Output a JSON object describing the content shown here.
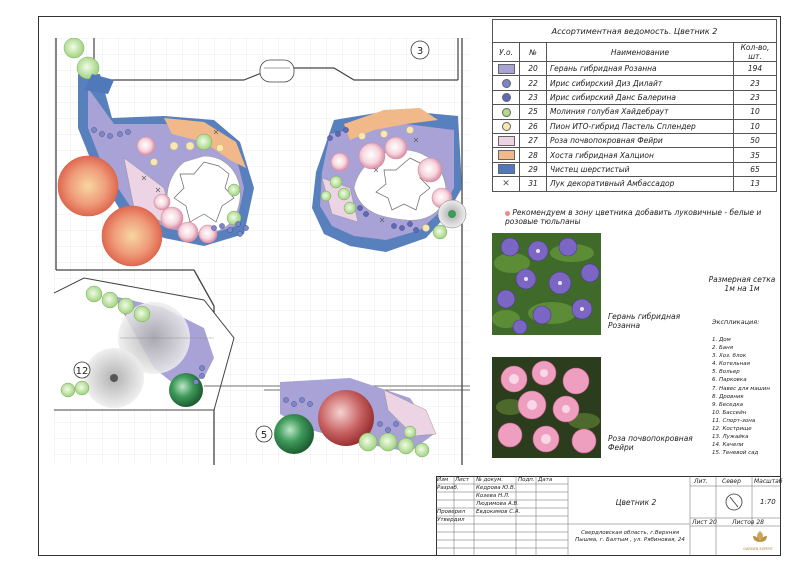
{
  "plan": {
    "labels": [
      "3",
      "12",
      "5"
    ]
  },
  "assortment": {
    "title": "Ассортиментная ведомость. Цветник 2",
    "headers": {
      "sym": "У.о.",
      "num": "№",
      "name": "Наименование",
      "qty": "Кол-во, шт."
    },
    "rows": [
      {
        "num": "20",
        "name": "Герань гибридная Розанна",
        "qty": "194",
        "symbol": "swatch",
        "color": "#a9a2d6"
      },
      {
        "num": "22",
        "name": "Ирис сибирский Диз Дилайт",
        "qty": "23",
        "symbol": "dot",
        "color": "#7c86c9"
      },
      {
        "num": "23",
        "name": "Ирис сибирский Данс Балерина",
        "qty": "23",
        "symbol": "dot",
        "color": "#5e6ab8"
      },
      {
        "num": "25",
        "name": "Молиния голубая Хайдебраут",
        "qty": "10",
        "symbol": "dot",
        "color": "#b3d98c"
      },
      {
        "num": "26",
        "name": "Пион ИТО-гибрид Пастель Сплендер",
        "qty": "10",
        "symbol": "dot",
        "color": "#f6e8b0"
      },
      {
        "num": "27",
        "name": "Роза почвопокровная Фейри",
        "qty": "50",
        "symbol": "swatch",
        "color": "#ecd4e4"
      },
      {
        "num": "28",
        "name": "Хоста гибридная Халцион",
        "qty": "35",
        "symbol": "swatch",
        "color": "#f1b98a"
      },
      {
        "num": "29",
        "name": "Чистец шерстистый",
        "qty": "65",
        "symbol": "swatch",
        "color": "#4f79b8"
      },
      {
        "num": "31",
        "name": "Лук декоративный Амбассадор",
        "qty": "13",
        "symbol": "cross",
        "color": "#555555"
      }
    ]
  },
  "recommendation": "Рекомендуем в зону цветника добавить луковичные - белые и розовые тюльпаны",
  "grid_note": "Размерная сетка 1м на 1м",
  "photos": [
    {
      "caption": "Герань гибридная Розанна"
    },
    {
      "caption": "Роза почвопокровная Фейри"
    }
  ],
  "legend": {
    "title": "Экспликация:",
    "items": [
      "1. Дом",
      "2. Баня",
      "3. Хоз. блок",
      "4. Котельная",
      "5. Вольер",
      "6. Парковка",
      "7. Навес для машин",
      "8. Дровник",
      "9. Беседка",
      "10. Бассейн",
      "11. Спорт-зона",
      "12. Кострище",
      "13. Лужайка",
      "14. Качели",
      "15. Теневой сад"
    ]
  },
  "stamp": {
    "header": [
      "Изм",
      "Лист",
      "№ докум.",
      "Подп.",
      "Дата"
    ],
    "roles": [
      {
        "role": "Разраб.",
        "name": "Кедрова Ю.В."
      },
      {
        "role": "",
        "name": "Козева Н.Л."
      },
      {
        "role": "",
        "name": "Людимова А.В."
      },
      {
        "role": "Проверил",
        "name": "Евдокимов С.А."
      },
      {
        "role": "Утвердил",
        "name": ""
      }
    ],
    "title": "Цветник 2",
    "address": "Свердловская область, г.Верхняя Пышма, г. Балтым , ул. Рябиновая, 24",
    "lit": "Лит.",
    "north": "Север",
    "scale_label": "Масштаб",
    "scale": "1:70",
    "sheet_label": "Лист",
    "sheet": "20",
    "sheets_label": "Листов",
    "sheets": "28",
    "logo": "GARDEN EXPERT"
  }
}
